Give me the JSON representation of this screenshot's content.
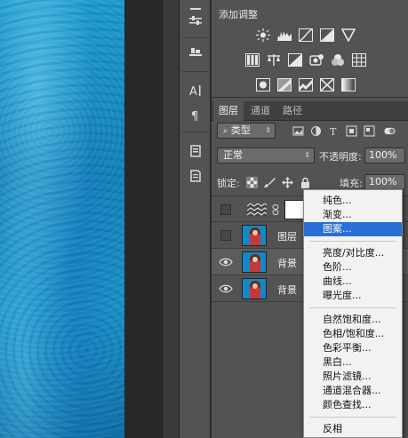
{
  "adjustments": {
    "title": "添加调整"
  },
  "layers_panel": {
    "tabs": [
      "图层",
      "通道",
      "路径"
    ],
    "filter": {
      "kind_label": "类型"
    },
    "blend": {
      "mode": "正常",
      "opacity_label": "不透明度:",
      "opacity_value": "100%"
    },
    "lock": {
      "label": "锁定:",
      "fill_label": "填充:",
      "fill_value": "100%"
    },
    "layers": [
      {
        "name": "",
        "visible": false,
        "type": "adjustment"
      },
      {
        "name": "图层",
        "visible": false,
        "type": "image"
      },
      {
        "name": "背景",
        "visible": true,
        "type": "image"
      },
      {
        "name": "背景",
        "visible": true,
        "type": "image"
      }
    ]
  },
  "menu": {
    "groups": [
      [
        "纯色...",
        "渐变...",
        "图案..."
      ],
      [
        "亮度/对比度...",
        "色阶...",
        "曲线...",
        "曝光度..."
      ],
      [
        "自然饱和度...",
        "色相/饱和度...",
        "色彩平衡...",
        "黑白...",
        "照片滤镜...",
        "通道混合器...",
        "颜色查找..."
      ],
      [
        "反相"
      ]
    ],
    "highlighted": "图案..."
  },
  "colors": {
    "menu_highlight": "#2b6fd6",
    "panel_bg": "#535353",
    "canvas_blue": "#1a8fca"
  }
}
